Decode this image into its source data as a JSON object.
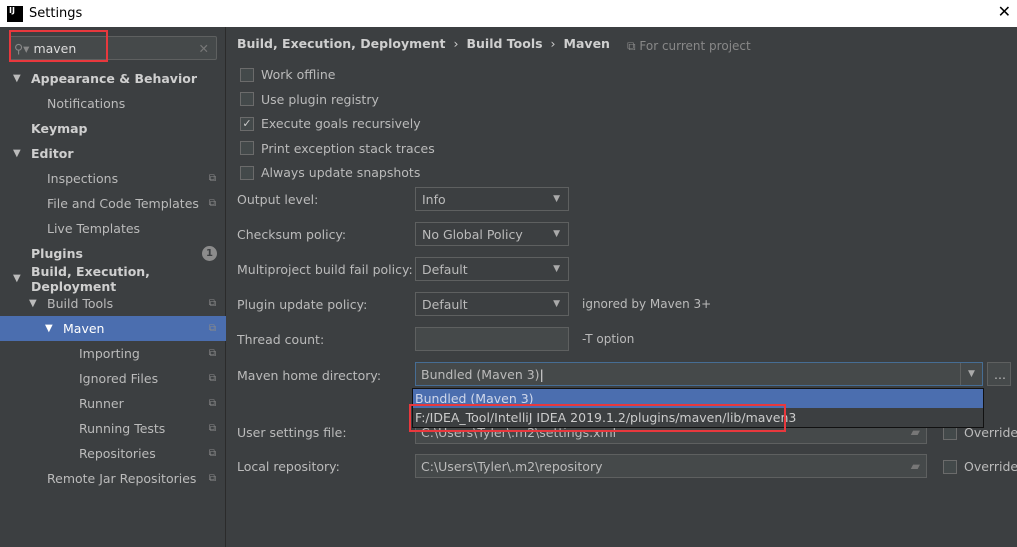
{
  "window": {
    "title": "Settings",
    "logo": "IJ"
  },
  "search": {
    "value": "maven",
    "icon": "search-icon"
  },
  "sidebar": {
    "items": [
      {
        "label": "Appearance & Behavior",
        "bold": true,
        "level": 0,
        "expanded": true
      },
      {
        "label": "Notifications",
        "level": 1
      },
      {
        "label": "Keymap",
        "bold": true,
        "level": 0
      },
      {
        "label": "Editor",
        "bold": true,
        "level": 0,
        "expanded": true
      },
      {
        "label": "Inspections",
        "level": 1,
        "project": true
      },
      {
        "label": "File and Code Templates",
        "level": 1,
        "project": true
      },
      {
        "label": "Live Templates",
        "level": 1
      },
      {
        "label": "Plugins",
        "bold": true,
        "level": 0,
        "badge": "1"
      },
      {
        "label": "Build, Execution, Deployment",
        "bold": true,
        "level": 0,
        "expanded": true
      },
      {
        "label": "Build Tools",
        "level": 1,
        "expanded": true,
        "project": true
      },
      {
        "label": "Maven",
        "level": 2,
        "expanded": true,
        "project": true,
        "selected": true
      },
      {
        "label": "Importing",
        "level": 3,
        "project": true
      },
      {
        "label": "Ignored Files",
        "level": 3,
        "project": true
      },
      {
        "label": "Runner",
        "level": 3,
        "project": true
      },
      {
        "label": "Running Tests",
        "level": 3,
        "project": true
      },
      {
        "label": "Repositories",
        "level": 3,
        "project": true
      },
      {
        "label": "Remote Jar Repositories",
        "level": 1,
        "project": true
      }
    ]
  },
  "breadcrumb": [
    "Build, Execution, Deployment",
    "Build Tools",
    "Maven"
  ],
  "for_project": "For current project",
  "checkboxes": [
    {
      "label": "Work offline",
      "checked": false
    },
    {
      "label": "Use plugin registry",
      "checked": false
    },
    {
      "label": "Execute goals recursively",
      "checked": true
    },
    {
      "label": "Print exception stack traces",
      "checked": false
    },
    {
      "label": "Always update snapshots",
      "checked": false
    }
  ],
  "fields": {
    "output_level": {
      "label": "Output level:",
      "value": "Info"
    },
    "checksum": {
      "label": "Checksum policy:",
      "value": "No Global Policy"
    },
    "multiproject": {
      "label": "Multiproject build fail policy:",
      "value": "Default"
    },
    "plugin_update": {
      "label": "Plugin update policy:",
      "value": "Default",
      "hint": "ignored by Maven 3+"
    },
    "thread_count": {
      "label": "Thread count:",
      "value": "",
      "hint": "-T option"
    },
    "maven_home": {
      "label": "Maven home directory:",
      "value": "Bundled (Maven 3)",
      "browse": "..."
    },
    "user_settings": {
      "label": "User settings file:",
      "value": "C:\\Users\\Tyler\\.m2\\settings.xml",
      "override": "Override"
    },
    "local_repo": {
      "label": "Local repository:",
      "value": "C:\\Users\\Tyler\\.m2\\repository",
      "override": "Override"
    }
  },
  "maven_home_options": [
    "Bundled (Maven 3)",
    "F:/IDEA_Tool/IntelliJ IDEA 2019.1.2/plugins/maven/lib/maven3"
  ],
  "colors": {
    "selection": "#4b6eaf",
    "background": "#3c3f41",
    "highlight_box": "#e8383d"
  }
}
